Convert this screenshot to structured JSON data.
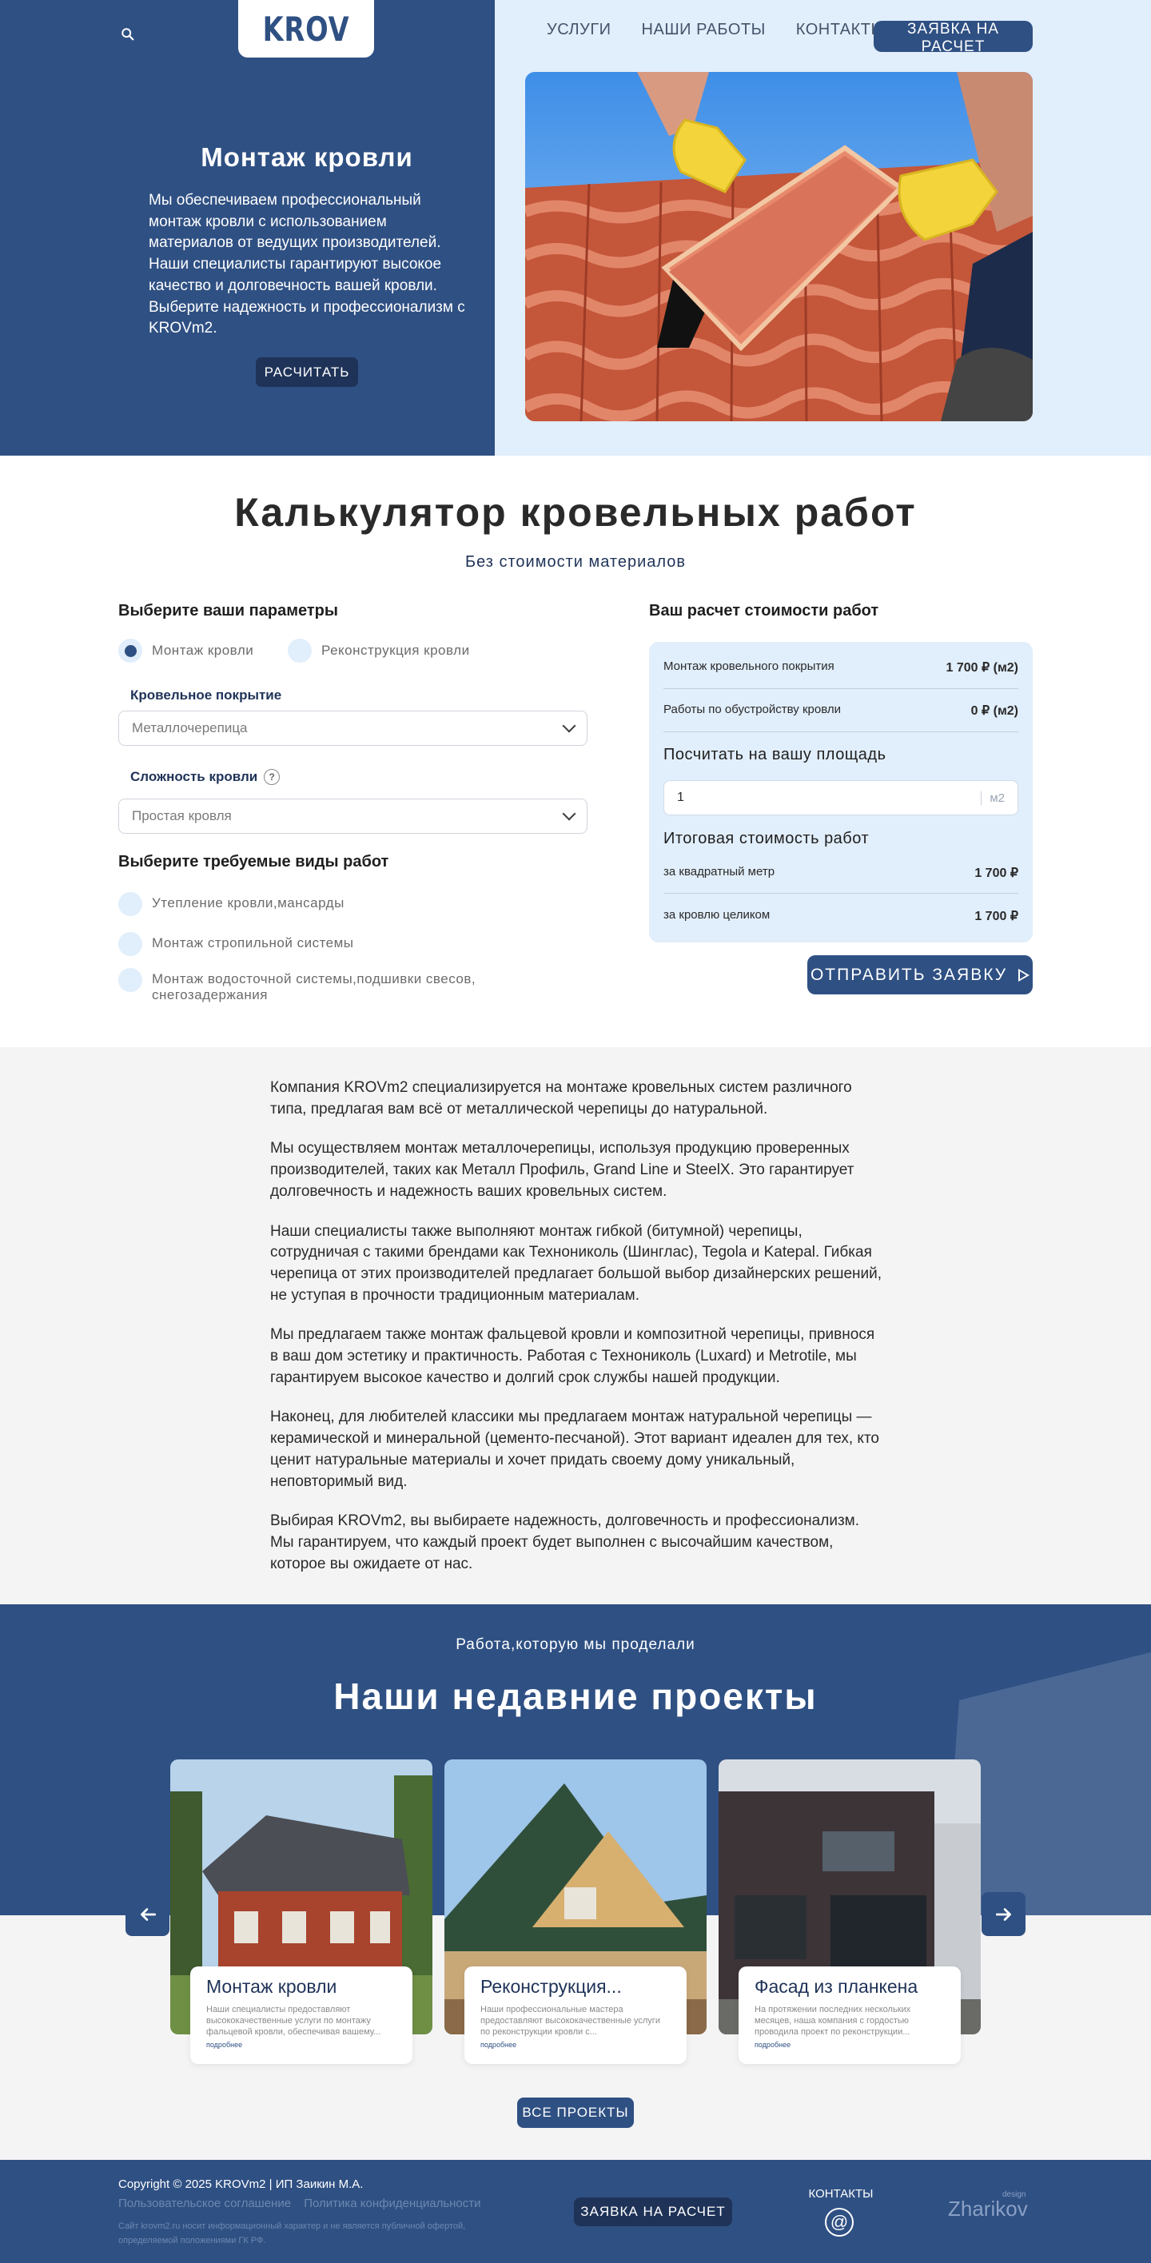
{
  "header": {
    "logo": "KROV",
    "nav": [
      "УСЛУГИ",
      "НАШИ РАБОТЫ",
      "КОНТАКТЫ"
    ],
    "cta": "ЗАЯВКА НА РАСЧЕТ"
  },
  "hero": {
    "title": "Монтаж кровли",
    "text": "Мы обеспечиваем профессиональный монтаж кровли с использованием материалов от ведущих производителей. Наши специалисты гарантируют высокое качество и долговечность вашей кровли. Выберите надежность и профессионализм с KROVm2.",
    "button": "РАСЧИТАТЬ"
  },
  "calculator": {
    "title": "Калькулятор кровельных работ",
    "subtitle": "Без стоимости материалов",
    "params_heading": "Выберите ваши параметры",
    "radio": [
      {
        "label": "Монтаж кровли",
        "checked": true
      },
      {
        "label": "Реконструкция кровли",
        "checked": false
      }
    ],
    "covering_label": "Кровельное покрытие",
    "covering_value": "Металлочерепица",
    "complexity_label": "Сложность кровли",
    "complexity_value": "Простая кровля",
    "works_heading": "Выберите требуемые виды работ",
    "works": [
      "Утепление кровли,мансарды",
      "Монтаж стропильной системы",
      "Монтаж водосточной системы,подшивки свесов, снегозадержания"
    ],
    "result": {
      "heading": "Ваш расчет стоимости работ",
      "rows": [
        {
          "label": "Монтаж кровельного покрытия",
          "value": "1 700 ₽ (м2)"
        },
        {
          "label": "Работы по обустройству кровли",
          "value": "0 ₽ (м2)"
        }
      ],
      "area_heading": "Посчитать на вашу площадь",
      "area_value": "1",
      "area_unit": "м2",
      "total_heading": "Итоговая стоимость работ",
      "totals": [
        {
          "label": "за квадратный метр",
          "value": "1 700 ₽"
        },
        {
          "label": "за кровлю целиком",
          "value": "1 700 ₽"
        }
      ]
    },
    "send_button": "ОТПРАВИТЬ ЗАЯВКУ"
  },
  "about": {
    "paragraphs": [
      "Компания KROVm2 специализируется на монтаже кровельных систем различного типа, предлагая вам всё от металлической черепицы до натуральной.",
      "Мы осуществляем монтаж металлочерепицы, используя продукцию проверенных производителей, таких как Металл Профиль, Grand Line и SteelX. Это гарантирует долговечность и надежность ваших кровельных систем.",
      "Наши специалисты также выполняют монтаж гибкой (битумной) черепицы, сотрудничая с такими брендами как Технониколь (Шинглас), Tegola и Katepal. Гибкая черепица от этих производителей предлагает большой выбор дизайнерских решений, не уступая в прочности традиционным материалам.",
      "Мы предлагаем также монтаж фальцевой кровли и композитной черепицы, привнося в ваш дом эстетику и практичность. Работая с Технониколь (Luxard) и Metrotile, мы гарантируем высокое качество и долгий срок службы нашей продукции.",
      "Наконец, для любителей классики мы предлагаем монтаж натуральной черепицы — керамической и минеральной (цементо-песчаной). Этот вариант идеален для тех, кто ценит натуральные материалы и хочет придать своему дому уникальный, неповторимый вид.",
      "Выбирая KROVm2, вы выбираете надежность, долговечность и профессионализм. Мы гарантируем, что каждый проект будет выполнен с высочайшим качеством, которое вы ожидаете от нас."
    ]
  },
  "projects": {
    "subtitle": "Работа,которую мы проделали",
    "title": "Наши недавние проекты",
    "cards": [
      {
        "title": "Монтаж кровли",
        "desc": "Наши специалисты предоставляют высококачественные услуги по монтажу фальцевой кровли, обеспечивая вашему...",
        "more": "подробнее"
      },
      {
        "title": "Реконструкция...",
        "desc": "Наши профессиональные мастера предоставляют высококачественные услуги по реконструкции кровли с...",
        "more": "подробнее"
      },
      {
        "title": "Фасад из планкена",
        "desc": "На протяжении последних нескольких месяцев, наша компания с гордостью проводила проект по реконструкции...",
        "more": "подробнее"
      }
    ],
    "all_button": "ВСЕ ПРОЕКТЫ"
  },
  "footer": {
    "copyright": "Copyright © 2025 KROVm2 | ИП Заикин М.А.",
    "links": [
      "Пользовательское соглашение",
      "Политика конфиденциальности"
    ],
    "notice": "Сайт krovm2.ru носит информационный характер и не является публичной офертой, определяемой положениями ГК РФ.",
    "cta": "ЗАЯВКА НА РАСЧЕТ",
    "contacts": "КОНТАКТЫ",
    "at": "@",
    "designer": "Zharikov",
    "designer_tag": "design"
  },
  "colors": {
    "primary": "#2f5083",
    "dark": "#1f3358",
    "light": "#e1eefb",
    "bg_gray": "#f4f4f5"
  }
}
